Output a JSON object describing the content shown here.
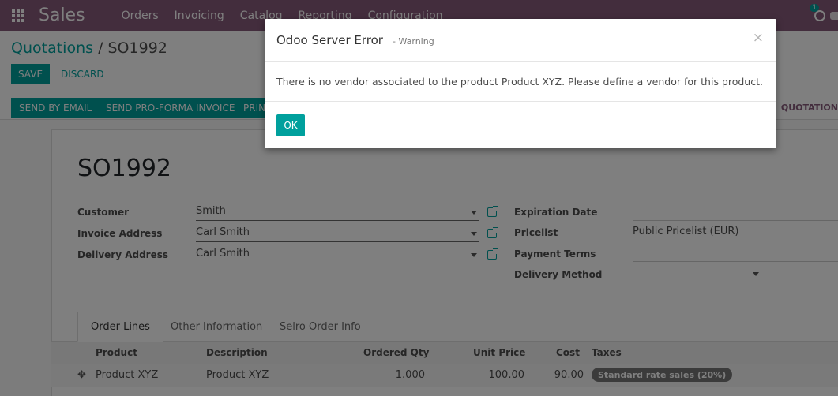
{
  "navbar": {
    "app_name": "Sales",
    "menu": [
      "Orders",
      "Invoicing",
      "Catalog",
      "Reporting",
      "Configuration"
    ],
    "activity_count": "1",
    "color": "#875a7b"
  },
  "breadcrumb": {
    "parent": "Quotations",
    "separator": " / ",
    "current": "SO1992"
  },
  "buttons": {
    "save": "SAVE",
    "discard": "DISCARD",
    "send_email": "SEND BY EMAIL",
    "send_proforma": "SEND PRO-FORMA INVOICE",
    "print": "PRINT",
    "state": "QUOTATION"
  },
  "form": {
    "title": "SO1992",
    "customer_label": "Customer",
    "customer_value": "Smith",
    "invoice_label": "Invoice Address",
    "invoice_value": "Carl Smith",
    "delivery_label": "Delivery Address",
    "delivery_value": "Carl Smith",
    "expiration_label": "Expiration Date",
    "expiration_value": "",
    "pricelist_label": "Pricelist",
    "pricelist_value": "Public Pricelist (EUR)",
    "payment_terms_label": "Payment Terms",
    "payment_terms_value": "",
    "delivery_method_label": "Delivery Method",
    "delivery_method_value": ""
  },
  "tabs": [
    "Order Lines",
    "Other Information",
    "Selro Order Info"
  ],
  "table": {
    "headers": [
      "Product",
      "Description",
      "Ordered Qty",
      "Unit Price",
      "Cost",
      "Taxes"
    ],
    "rows": [
      {
        "product": "Product XYZ",
        "description": "Product XYZ",
        "qty": "1.000",
        "unit_price": "100.00",
        "cost": "90.00",
        "tax": "Standard rate sales (20%)"
      }
    ]
  },
  "modal": {
    "title": "Odoo Server Error",
    "subtitle": "- Warning",
    "close": "×",
    "message": "There is no vendor associated to the product Product XYZ. Please define a vendor for this product.",
    "ok": "OK"
  },
  "colors": {
    "primary": "#00a09d",
    "brand": "#875a7b"
  }
}
